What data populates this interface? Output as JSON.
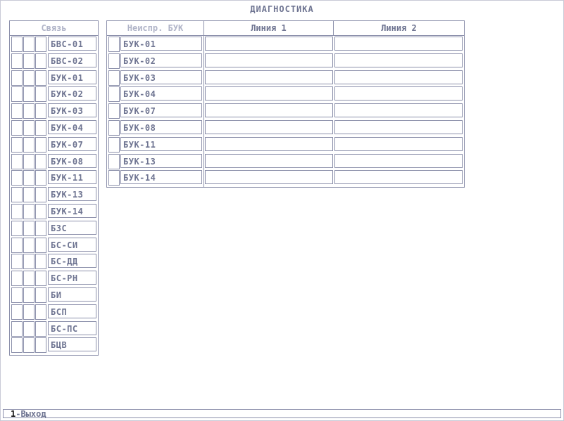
{
  "window": {
    "title": "ДИАГНОСТИКА"
  },
  "left_panel": {
    "header": "Связь",
    "items": [
      {
        "label": "БВС-01"
      },
      {
        "label": "БВС-02"
      },
      {
        "label": "БУК-01"
      },
      {
        "label": "БУК-02"
      },
      {
        "label": "БУК-03"
      },
      {
        "label": "БУК-04"
      },
      {
        "label": "БУК-07"
      },
      {
        "label": "БУК-08"
      },
      {
        "label": "БУК-11"
      },
      {
        "label": "БУК-13"
      },
      {
        "label": "БУК-14"
      },
      {
        "label": "БЗС"
      },
      {
        "label": "БС-СИ"
      },
      {
        "label": "БС-ДД"
      },
      {
        "label": "БС-РН"
      },
      {
        "label": "БИ"
      },
      {
        "label": "БСП"
      },
      {
        "label": "БС-ПС"
      },
      {
        "label": "БЦВ"
      }
    ]
  },
  "right_panel": {
    "headers": [
      "Неиспр. БУК",
      "Линия 1",
      "Линия 2"
    ],
    "rows": [
      {
        "label": "БУК-01",
        "line1": "",
        "line2": ""
      },
      {
        "label": "БУК-02",
        "line1": "",
        "line2": ""
      },
      {
        "label": "БУК-03",
        "line1": "",
        "line2": ""
      },
      {
        "label": "БУК-04",
        "line1": "",
        "line2": ""
      },
      {
        "label": "БУК-07",
        "line1": "",
        "line2": ""
      },
      {
        "label": "БУК-08",
        "line1": "",
        "line2": ""
      },
      {
        "label": "БУК-11",
        "line1": "",
        "line2": ""
      },
      {
        "label": "БУК-13",
        "line1": "",
        "line2": ""
      },
      {
        "label": "БУК-14",
        "line1": "",
        "line2": ""
      }
    ]
  },
  "status_bar": {
    "key": "1",
    "action": "-Выход"
  }
}
